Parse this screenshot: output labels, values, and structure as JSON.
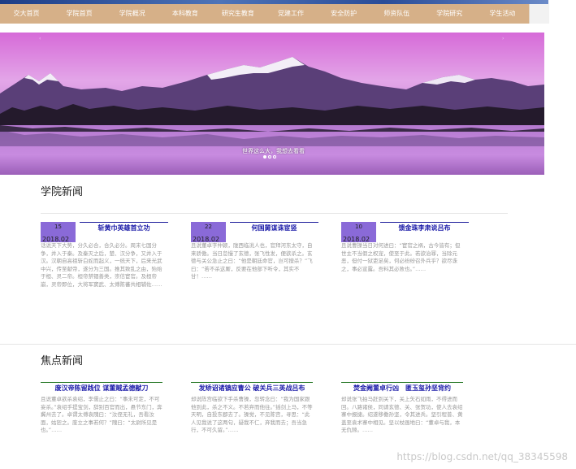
{
  "nav": {
    "items": [
      "交大首页",
      "学院首页",
      "学院概况",
      "本科教育",
      "研究生教育",
      "党建工作",
      "安全防护",
      "师资队伍",
      "学院研究",
      "学生活动"
    ]
  },
  "banner": {
    "caption": "世界这么大，我想去看看",
    "arrow_left": "‹",
    "arrow_right": "›",
    "slide_count": 3,
    "active_slide": 0
  },
  "news": {
    "title": "学院新闻",
    "items": [
      {
        "day": "15",
        "ym": "2018.02",
        "title": "斩黄巾英雄首立功",
        "text": "话说天下大势，分久必合，合久必分。周末七国分争，并入于秦。及秦灭之后，楚、汉分争，又并入于汉。汉朝自高祖斩白蛇而起义，一统天下，后来光武中兴，传至献帝，遂分为三国。推其致乱之由，殆始于桓、灵二帝。桓帝禁锢善类，崇信宦官。及桓帝崩，灵帝即位，大将军窦武、太傅陈蕃共相辅佐……"
      },
      {
        "day": "22",
        "ym": "2018.02",
        "title": "何国舅谋诛宦竖",
        "text": "且说董卓字仲颖，陇西临洮人也，官拜河东太守，自来骄傲。当日怠慢了玄德，张飞性发，便欲杀之。玄德与关公急止之曰：“他是朝廷命官，岂可擅杀？”飞曰：“若不杀这厮，反要在他部下听令，其实不甘！……"
      },
      {
        "day": "10",
        "ym": "2018.02",
        "title": "馈金珠李肃说吕布",
        "text": "且说曹操当日对何进曰：“宦官之祸，古今皆有；但世主不当假之权宠，使至于此。若欲治罪，当除元恶，但付一狱吏足矣，何必纷纷召外兵乎？欲尽诛之，事必宣露。吾料其必败也。”……"
      }
    ]
  },
  "focus": {
    "title": "焦点新闻",
    "items": [
      {
        "title": "废汉帝陈留践位 谋董贼孟德献刀",
        "text": "且说董卓欲杀袁绍，李儒止之曰：“事未可定，不可妄杀。”袁绍手提宝剑，辞别百官而出，悬节东门，奔冀州去了。卓谓太傅袁隗曰：“汝侄无礼，吾看汝面，姑恕之。废立之事若何？”隗曰：“太尉所见是也。”……"
      },
      {
        "title": "发矫诏诸镇应曹公 破关兵三英战吕布",
        "text": "却说陈宫临欲下手杀曹操，忽转念曰：“我为国家跟他到此，杀之不义。不若弃而他往。”插剑上马，不等天明，自投东郡去了。操觉，不见陈宫，寻思：“此人见我说了这两句，疑我不仁，弃我而去；吾当急行，不可久留。”……"
      },
      {
        "title": "焚金阙董卓行凶　匿玉玺孙坚背约",
        "text": "却说张飞拍马赶到关下，关上矢石如雨，不得进而回。八路诸侯，同请玄德、关、张贺功，使人去袁绍寨中报捷。绍遂移檄孙坚，令其进兵。坚引程普、黄盖至袁术寨中相见。坚以杖画地曰：“董卓与我，本无仇隙。……"
      }
    ]
  },
  "watermark": "https://blog.csdn.net/qq_38345598",
  "colors": {
    "nav_bg": "#d6b088",
    "date_box": "#8a6ad8",
    "news_title": "#1a1aa8",
    "focus_rule": "#2a7a2a"
  }
}
